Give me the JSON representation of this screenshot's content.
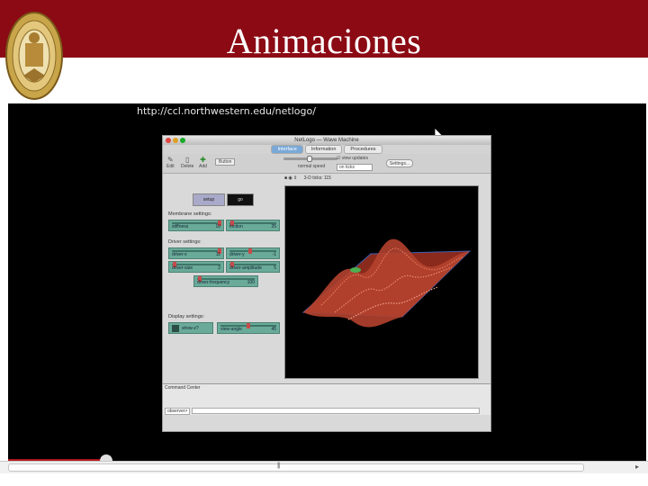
{
  "slide": {
    "title": "Animaciones",
    "header_color": "#8b0a14",
    "logo_icon": "university-seal-icon"
  },
  "video": {
    "url": "http://ccl.northwestern.edu/netlogo/",
    "cursor_icon": "mouse-pointer-icon",
    "window_title": "NetLogo — Wave Machine",
    "tabs": [
      "Interface",
      "Information",
      "Procedures"
    ],
    "active_tab": "Interface",
    "toolbar": {
      "edit": "Edit",
      "delete": "Delete",
      "add": "Add",
      "widget_type": "Button",
      "speed_label": "normal speed",
      "view_updates": "view updates",
      "update_mode": "on ticks",
      "settings": "Settings..."
    },
    "buttons": {
      "setup": "setup",
      "go": "go"
    },
    "sections": {
      "membrane": "Membrane settings:",
      "driver": "Driver settings:",
      "display": "Display settings:"
    },
    "sliders": {
      "stiffness": {
        "name": "stiffness",
        "value": "10"
      },
      "friction": {
        "name": "friction",
        "value": "25"
      },
      "driver_x": {
        "name": "driver-x",
        "value": "11"
      },
      "driver_y": {
        "name": "driver-y",
        "value": "-1"
      },
      "driver_size": {
        "name": "driver-size",
        "value": "2"
      },
      "driver_amplitude": {
        "name": "driver-amplitude",
        "value": "5"
      },
      "driver_frequency": {
        "name": "driver-frequency",
        "value": "100"
      },
      "view_angle": {
        "name": "view-angle",
        "value": "45"
      }
    },
    "switch": {
      "state": "Off",
      "name": "show-z?"
    },
    "view_header": "3-D  ticks: 115",
    "command_center": {
      "label": "Command Center",
      "observer": "observer>"
    }
  }
}
